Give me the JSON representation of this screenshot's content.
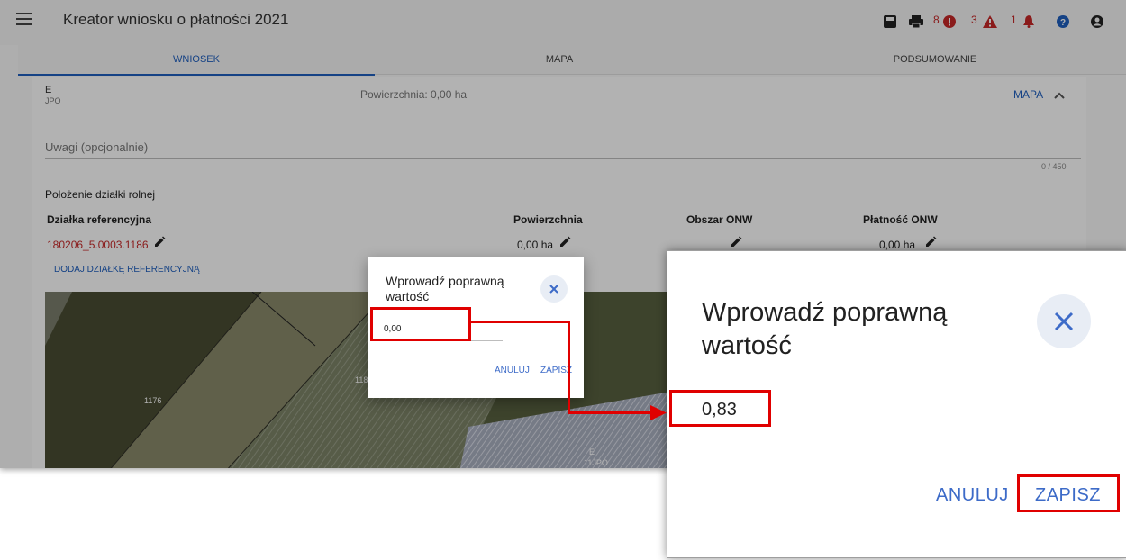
{
  "app": {
    "title": "Kreator wniosku o płatności 2021",
    "counts": {
      "errors": "8",
      "warnings": "3",
      "notifications": "1"
    }
  },
  "tabs": [
    {
      "label": "WNIOSEK",
      "active": true
    },
    {
      "label": "MAPA",
      "active": false
    },
    {
      "label": "PODSUMOWANIE",
      "active": false
    }
  ],
  "parcel": {
    "letter": "E",
    "type": "JPO",
    "area_label": "Powierzchnia: 0,00 ha",
    "map_button": "MAPA"
  },
  "notes": {
    "placeholder": "Uwagi (opcjonalnie)",
    "counter": "0 / 450"
  },
  "location_label": "Położenie działki rolnej",
  "table": {
    "headers": [
      "Działka referencyjna",
      "Powierzchnia",
      "Obszar ONW",
      "Płatność ONW"
    ],
    "row": {
      "parcel_id": "180206_5.0003.1186",
      "area": "0,00 ha",
      "onw_payment": "0,00 ha"
    },
    "add_button": "DODAJ DZIAŁKĘ REFERENCYJNĄ"
  },
  "map_labels": [
    "1176",
    "1181",
    "E",
    "11JPO"
  ],
  "small_dialog": {
    "title": "Wprowadź poprawną wartość",
    "value": "0,00",
    "cancel": "ANULUJ",
    "save": "ZAPISZ"
  },
  "zoom_dialog": {
    "title": "Wprowadź poprawną wartość",
    "value": "0,83",
    "cancel": "ANULUJ",
    "save": "ZAPISZ"
  },
  "colors": {
    "accent": "#1f5fbf",
    "error": "#c62828",
    "highlight": "#e00000"
  }
}
